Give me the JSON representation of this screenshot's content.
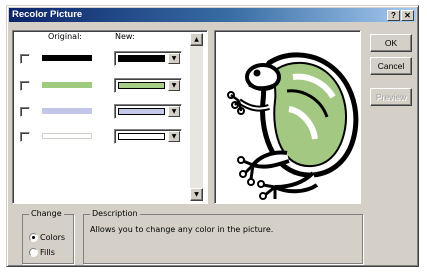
{
  "window": {
    "title": "Recolor Picture",
    "help_label": "?",
    "close_label": "✕"
  },
  "columns": {
    "original": "Original:",
    "new": "New:"
  },
  "rows": [
    {
      "original_color": "#000000",
      "new_color": "#000000"
    },
    {
      "original_color": "#9fcb7f",
      "new_color": "#a8cf8a"
    },
    {
      "original_color": "#c3c6e8",
      "new_color": "#c6c8ea"
    },
    {
      "original_color": "#ffffff",
      "new_color": "#ffffff"
    }
  ],
  "buttons": {
    "ok": "OK",
    "cancel": "Cancel",
    "preview": "Preview"
  },
  "change": {
    "legend": "Change",
    "options": [
      {
        "label": "Colors",
        "selected": true
      },
      {
        "label": "Fills",
        "selected": false
      }
    ]
  },
  "description": {
    "legend": "Description",
    "text": "Allows you to change any color in the picture."
  },
  "icons": {
    "dropdown": "triangle-down",
    "scroll_up": "triangle-up",
    "scroll_down": "triangle-down"
  },
  "preview_image": "frog-clipart",
  "colors": {
    "titlebar_start": "#0a246a",
    "titlebar_end": "#a6caf0",
    "dialog_bg": "#d4d0c8",
    "frog_green": "#a3c882"
  }
}
